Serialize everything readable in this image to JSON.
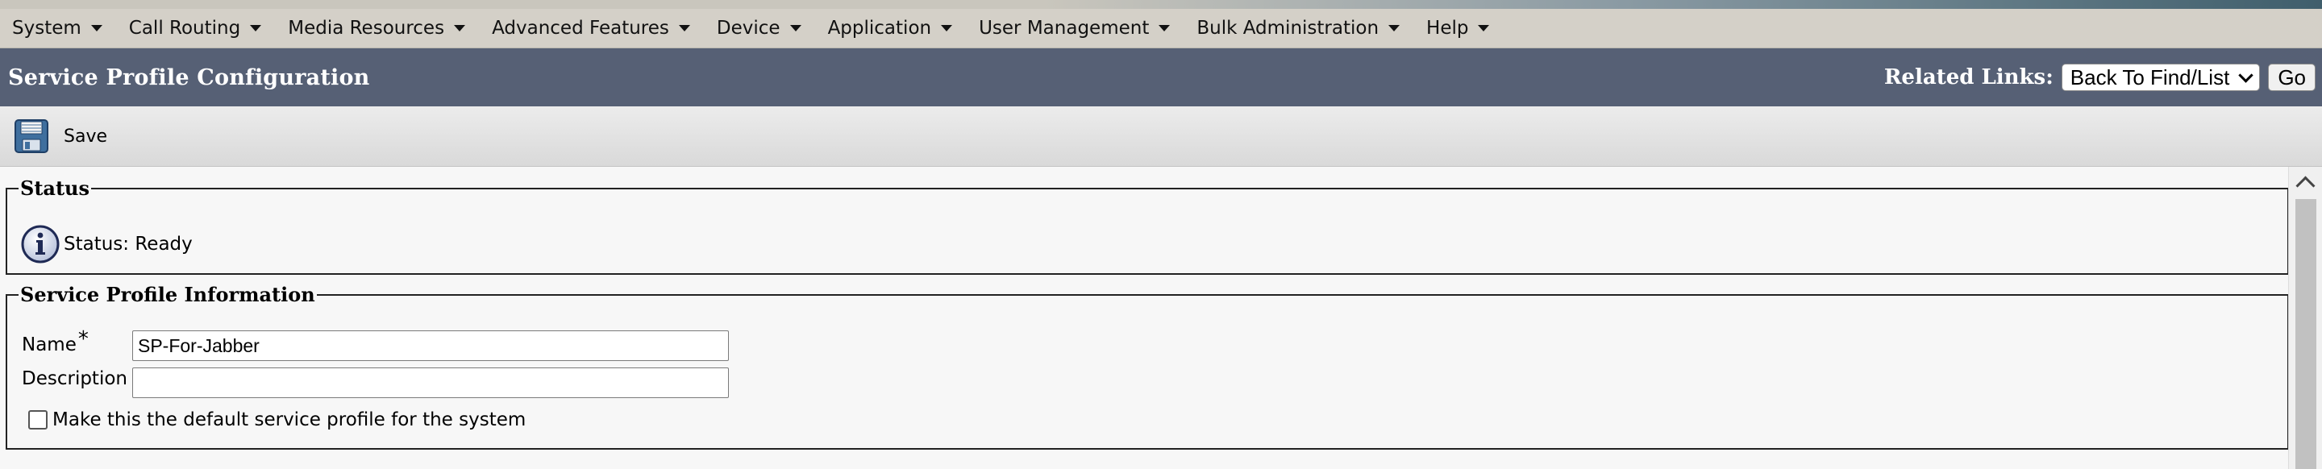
{
  "menu": {
    "items": [
      {
        "label": "System"
      },
      {
        "label": "Call Routing"
      },
      {
        "label": "Media Resources"
      },
      {
        "label": "Advanced Features"
      },
      {
        "label": "Device"
      },
      {
        "label": "Application"
      },
      {
        "label": "User Management"
      },
      {
        "label": "Bulk Administration"
      },
      {
        "label": "Help"
      }
    ]
  },
  "header": {
    "title": "Service Profile Configuration",
    "related_links_label": "Related Links:",
    "related_links_value": "Back To Find/List",
    "go_label": "Go"
  },
  "toolbar": {
    "save_label": "Save",
    "save_icon": "floppy-disk-icon"
  },
  "status_section": {
    "legend": "Status",
    "icon": "info-icon",
    "text": "Status: Ready"
  },
  "info_section": {
    "legend": "Service Profile Information",
    "name_label": "Name",
    "name_required": "*",
    "name_value": "SP-For-Jabber",
    "description_label": "Description",
    "description_value": "",
    "default_checkbox_label": "Make this the default service profile for the system",
    "default_checked": false
  },
  "colors": {
    "menubar": "#d4d0c8",
    "titlebar": "#566075",
    "content_bg": "#f7f7f7"
  }
}
